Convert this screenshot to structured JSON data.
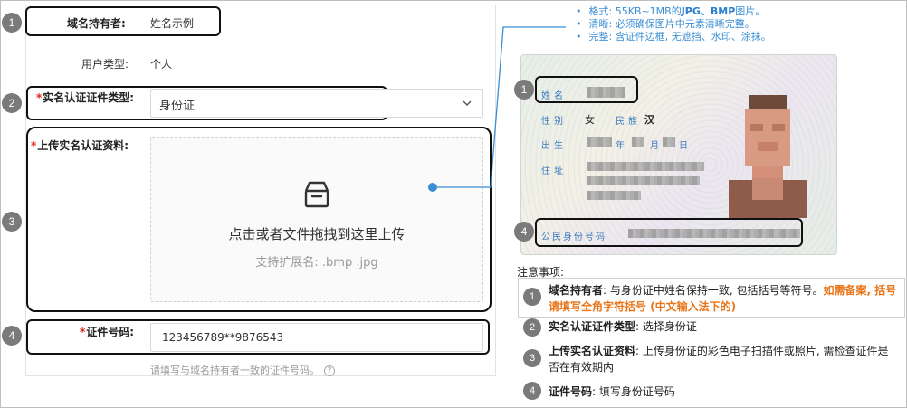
{
  "form": {
    "owner_label": "域名持有者:",
    "owner_value": "姓名示例",
    "user_type_label": "用户类型:",
    "user_type_value": "个人",
    "required_mark": "*",
    "cert_type_label": "实名认证证件类型:",
    "cert_type_value": "身份证",
    "upload_label": "上传实名认证资料:",
    "upload_title": "点击或者文件拖拽到这里上传",
    "upload_sub": "支持扩展名: .bmp .jpg",
    "cert_no_label": "证件号码:",
    "cert_no_value": "123456789**9876543",
    "cert_no_hint": "请填写与域名持有者一致的证件号码。",
    "help_glyph": "?"
  },
  "markers": [
    "1",
    "2",
    "3",
    "4"
  ],
  "tips": {
    "format_prefix": "格式: 55KB~1MB的",
    "format_bold": "JPG、BMP",
    "format_suffix": "图片。",
    "clear": "清晰: 必须确保图片中元素清晰完整。",
    "complete": "完整: 含证件边框, 无遮挡、水印、涂抹。"
  },
  "id_card": {
    "name_label": "姓名",
    "gender_label": "性别",
    "gender_value": "女",
    "ethnic_label": "民族",
    "ethnic_value": "汉",
    "birth_label": "出生",
    "year_char": "年",
    "month_char": "月",
    "day_char": "日",
    "address_label": "住址",
    "id_label": "公民身份号码"
  },
  "notes": {
    "title": "注意事项:",
    "n1_bold": "域名持有者",
    "n1_text": ": 与身份证中姓名保持一致, 包括括号等符号。",
    "n1_orange": "如需备案, 括号请填写全角字符括号 (中文输入法下的)",
    "n2_bold": "实名认证证件类型",
    "n2_text": ": 选择身份证",
    "n3_bold": "上传实名认证资料",
    "n3_text": ": 上传身份证的彩色电子扫描件或照片, 需检查证件是否在有效期内",
    "n4_bold": "证件号码",
    "n4_text": ": 填写身份证号码"
  },
  "colors": {
    "marker": "#7a7a7a",
    "tip_blue": "#3a8ed4",
    "required_red": "#e0241a",
    "warn_orange": "#e8751a",
    "connector_blue": "#3a8ed4"
  }
}
